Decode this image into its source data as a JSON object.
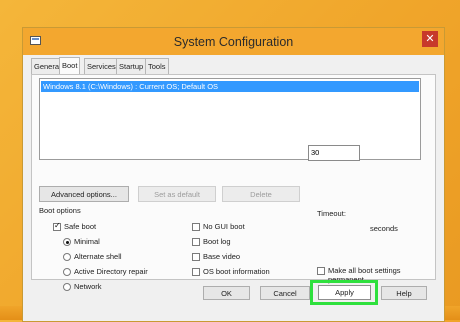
{
  "window": {
    "title": "System Configuration",
    "close_glyph": "✕"
  },
  "tabs": [
    {
      "label": "General"
    },
    {
      "label": "Boot"
    },
    {
      "label": "Services"
    },
    {
      "label": "Startup"
    },
    {
      "label": "Tools"
    }
  ],
  "os_list": {
    "items": [
      "Windows 8.1 (C:\\Windows) : Current OS; Default OS"
    ]
  },
  "buttons": {
    "advanced": "Advanced options...",
    "set_default": "Set as default",
    "delete": "Delete"
  },
  "boot_options": {
    "title": "Boot options",
    "safe_boot": "Safe boot",
    "minimal": "Minimal",
    "alternate_shell": "Alternate shell",
    "active_directory_repair": "Active Directory repair",
    "network": "Network",
    "no_gui_boot": "No GUI boot",
    "boot_log": "Boot log",
    "base_video": "Base video",
    "os_boot_information": "OS boot information"
  },
  "timeout": {
    "label": "Timeout:",
    "value": "30",
    "unit": "seconds"
  },
  "make_permanent": {
    "line1": "Make all boot settings",
    "line2": "permanent"
  },
  "footer": {
    "ok": "OK",
    "cancel": "Cancel",
    "apply": "Apply",
    "help": "Help"
  },
  "colors": {
    "accent": "#3399ff",
    "highlight": "#2ee03d",
    "background": "#f4b63a"
  }
}
